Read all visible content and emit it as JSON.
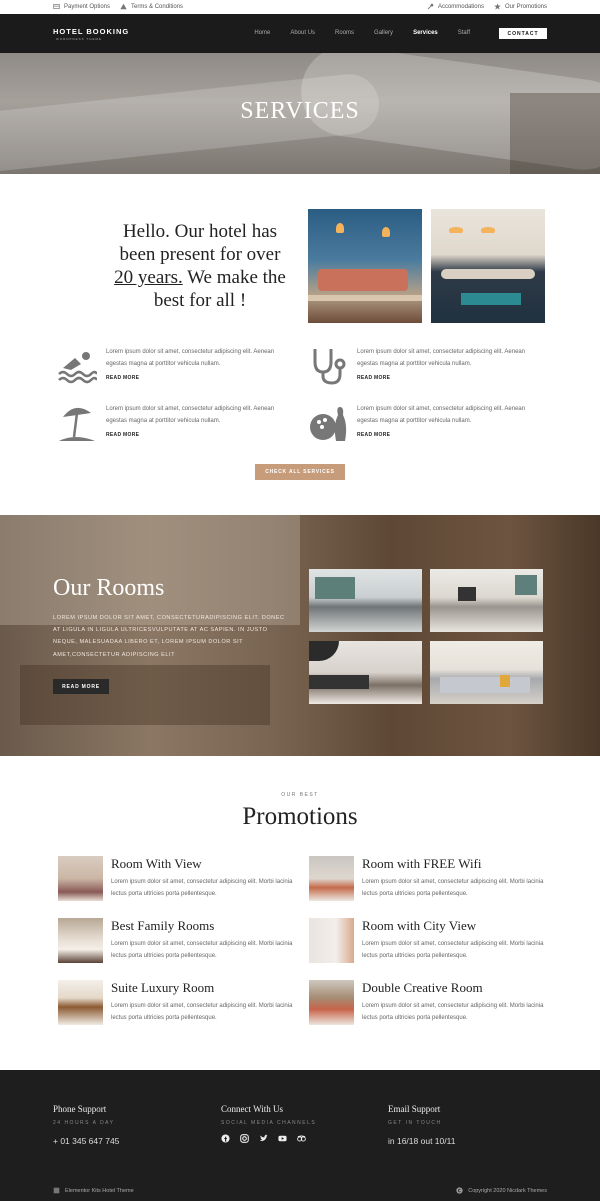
{
  "topbar": {
    "payment": "Payment Options",
    "terms": "Terms & Conditions",
    "accommodations": "Accommodations",
    "promotions": "Our Promotions"
  },
  "header": {
    "logo": "HOTEL BOOKING",
    "tagline": "WORDPRESS THEME",
    "nav": [
      "Home",
      "About Us",
      "Rooms",
      "Gallery",
      "Services",
      "Staff"
    ],
    "active": "Services",
    "contact": "CONTACT"
  },
  "hero": {
    "title": "SERVICES"
  },
  "intro": {
    "line1": "Hello. Our hotel has",
    "line2": "been present for over",
    "underlined": "20 years.",
    "line3": " We make the",
    "line4": "best for all !"
  },
  "services": [
    {
      "icon": "swimmer-icon",
      "text": "Lorem ipsum dolor sit amet, consectetur adipiscing elit. Aenean egestas magna at porttitor vehicula nullam.",
      "link": "READ MORE"
    },
    {
      "icon": "stethoscope-icon",
      "text": "Lorem ipsum dolor sit amet, consectetur adipiscing elit. Aenean egestas magna at porttitor vehicula nullam.",
      "link": "READ MORE"
    },
    {
      "icon": "beach-umbrella-icon",
      "text": "Lorem ipsum dolor sit amet, consectetur adipiscing elit. Aenean egestas magna at porttitor vehicula nullam.",
      "link": "READ MORE"
    },
    {
      "icon": "bowling-icon",
      "text": "Lorem ipsum dolor sit amet, consectetur adipiscing elit. Aenean egestas magna at porttitor vehicula nullam.",
      "link": "READ MORE"
    }
  ],
  "check_all": "CHECK ALL SERVICES",
  "rooms": {
    "title": "Our Rooms",
    "text": "LOREM IPSUM DOLOR SIT AMET, CONSECTETURADIPISCING ELIT. DONEC AT LIGULA IN LIGULA ULTRICESVULPUTATE AT AC SAPIEN. IN JUSTO NEQUE, MALESUADAA LIBERO ET, LOREM IPSUM DOLOR SIT AMET,CONSECTETUR ADIPISCING ELIT",
    "button": "READ MORE"
  },
  "promotions": {
    "pre": "OUR BEST",
    "title": "Promotions",
    "items": [
      {
        "title": "Room With View",
        "text": "Lorem ipsum dolor sit amet, consectetur adipiscing elit. Morbi lacinia lectus porta ultricies porta pellentesque."
      },
      {
        "title": "Room with FREE Wifi",
        "text": "Lorem ipsum dolor sit amet, consectetur adipiscing elit. Morbi lacinia lectus porta ultricies porta pellentesque."
      },
      {
        "title": "Best Family Rooms",
        "text": "Lorem ipsum dolor sit amet, consectetur adipiscing elit. Morbi lacinia lectus porta ultricies porta pellentesque."
      },
      {
        "title": "Room with City View",
        "text": "Lorem ipsum dolor sit amet, consectetur adipiscing elit. Morbi lacinia lectus porta ultricies porta pellentesque."
      },
      {
        "title": "Suite Luxury Room",
        "text": "Lorem ipsum dolor sit amet, consectetur adipiscing elit. Morbi lacinia lectus porta ultricies porta pellentesque."
      },
      {
        "title": "Double Creative Room",
        "text": "Lorem ipsum dolor sit amet, consectetur adipiscing elit. Morbi lacinia lectus porta ultricies porta pellentesque."
      }
    ]
  },
  "footer": {
    "phone": {
      "heading": "Phone Support",
      "sub": "24 HOURS A DAY",
      "value": "+ 01 345 647 745"
    },
    "connect": {
      "heading": "Connect With Us",
      "sub": "SOCIAL MEDIA CHANNELS"
    },
    "email": {
      "heading": "Email Support",
      "sub": "GET IN TOUCH",
      "value": "in 16/18 out 10/11"
    },
    "social_icons": [
      "facebook-icon",
      "instagram-icon",
      "twitter-icon",
      "youtube-icon",
      "tripadvisor-icon"
    ],
    "bottom_left": "Elementor Kits Hotel Theme",
    "bottom_right": "Copyright 2020 Nicdark Themes"
  },
  "colors": {
    "accent": "#c69c7b",
    "dark": "#1b1b1b",
    "footer": "#1e1e1e"
  }
}
